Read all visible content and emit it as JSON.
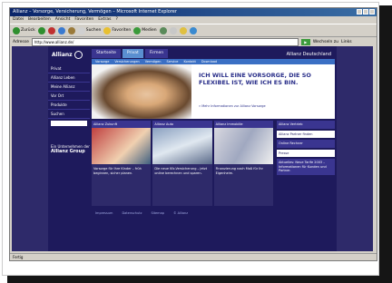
{
  "window": {
    "title": "Allianz – Vorsorge, Versicherung, Vermögen – Microsoft Internet Explorer"
  },
  "menubar": [
    "Datei",
    "Bearbeiten",
    "Ansicht",
    "Favoriten",
    "Extras",
    "?"
  ],
  "toolbar": {
    "back": "Zurück",
    "search": "Suchen",
    "favorites": "Favoriten",
    "media": "Medien"
  },
  "address": {
    "label": "Adresse",
    "value": "http://www.allianz.de/",
    "go": "Wechseln zu",
    "links": "Links"
  },
  "site": {
    "logo": "Allianz",
    "nav": [
      "Startseite",
      "Privat",
      "Firmen"
    ],
    "nav_active": "Privat",
    "brand_right": "Allianz Deutschland",
    "subnav": [
      "Vorsorge",
      "Versicherungen",
      "Vermögen",
      "Service",
      "Kontakt",
      "Download"
    ],
    "sidebar": [
      "Privat",
      "Allianz Leben",
      "Meine Allianz",
      "Vor Ort",
      "Produkte",
      "Suchen"
    ],
    "sidebar_bottom": {
      "line": "Ein Unternehmen der",
      "brand": "Allianz Group"
    },
    "hero": {
      "headline": "ICH WILL EINE VORSORGE, DIE SO FLEXIBEL IST, WIE ICH ES BIN.",
      "link": "» Mehr Informationen zur Allianz Vorsorge"
    },
    "teasers": [
      {
        "head": "Allianz Zukunft",
        "text": "Vorsorge für Ihre Kinder – früh beginnen, sicher planen."
      },
      {
        "head": "Allianz Auto",
        "text": "Die neue Kfz-Versicherung – jetzt online berechnen und sparen."
      },
      {
        "head": "Allianz Immobilie",
        "text": "Finanzierung nach Maß für Ihr Eigenheim."
      }
    ],
    "rightcol": [
      "Allianz Vertrieb",
      "Allianz Partner finden",
      "Online Rechner",
      "Presse",
      "Aktuelles: Neue Tarife 2003 – Informationen für Kunden und Partner."
    ],
    "footer": [
      "Impressum",
      "Datenschutz",
      "Sitemap",
      "© Allianz"
    ]
  },
  "statusbar": "Fertig",
  "colors": {
    "brand": "#1e1a5c",
    "accent": "#3a6fc4",
    "text_accent": "#2a2f8a"
  }
}
